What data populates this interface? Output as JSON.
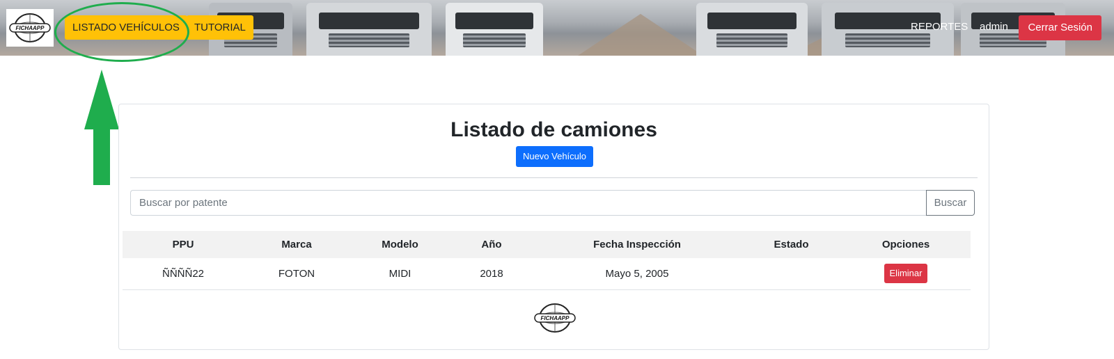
{
  "navbar": {
    "logo_text": "FICHAAPP",
    "nav_items": [
      "LISTADO VEHÍCULOS",
      "TUTORIAL"
    ],
    "reports_label": "REPORTES",
    "user_label": "admin",
    "logout_label": "Cerrar Sesión"
  },
  "main": {
    "title": "Listado de camiones",
    "new_vehicle_label": "Nuevo Vehículo",
    "search": {
      "placeholder": "Buscar por patente",
      "value": "",
      "button_label": "Buscar"
    },
    "table": {
      "columns": [
        "PPU",
        "Marca",
        "Modelo",
        "Año",
        "Fecha Inspección",
        "Estado",
        "Opciones"
      ],
      "rows": [
        {
          "ppu": "ÑÑÑÑ22",
          "marca": "FOTON",
          "modelo": "MIDI",
          "anio": "2018",
          "fecha": "Mayo 5, 2005",
          "estado": "",
          "action_label": "Eliminar"
        }
      ]
    },
    "footer_logo_text": "FICHAAPP"
  },
  "annotation": {
    "highlight_color": "#1fad4d",
    "highlighted_item": "LISTADO VEHÍCULOS",
    "arrow_icon": "arrow-up-icon"
  },
  "colors": {
    "warning": "#ffc107",
    "danger": "#dc3545",
    "primary": "#0d6efd",
    "secondary": "#6c757d"
  }
}
